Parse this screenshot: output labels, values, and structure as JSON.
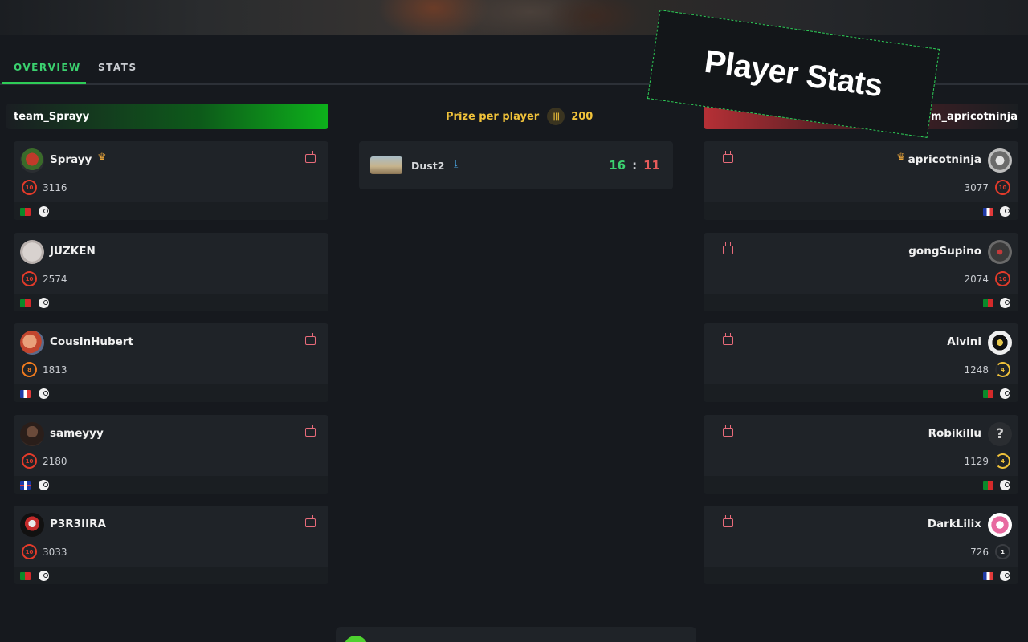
{
  "tabs": [
    {
      "label": "OVERVIEW",
      "active": true
    },
    {
      "label": "STATS",
      "active": false
    }
  ],
  "teams": {
    "left": {
      "name": "team_Sprayy",
      "color": "#0db21b"
    },
    "right": {
      "name": "team_apricotninja",
      "visible_name": "am_apricotninja",
      "color": "#b63036"
    }
  },
  "prize": {
    "label": "Prize per player",
    "amount": "200",
    "icon": "coin-icon"
  },
  "match": {
    "map": "Dust2",
    "score_left": "16",
    "score_sep": ":",
    "score_right": "11"
  },
  "players_left": [
    {
      "name": "Sprayy",
      "elo": "3116",
      "level": "10",
      "captain": true,
      "flag": "pt"
    },
    {
      "name": "JUZKEN",
      "elo": "2574",
      "level": "10",
      "captain": false,
      "flag": "pt"
    },
    {
      "name": "CousinHubert",
      "elo": "1813",
      "level": "8",
      "captain": false,
      "flag": "fr"
    },
    {
      "name": "sameyyy",
      "elo": "2180",
      "level": "10",
      "captain": false,
      "flag": "gb"
    },
    {
      "name": "P3R3IIRA",
      "elo": "3033",
      "level": "10",
      "captain": false,
      "flag": "pt"
    }
  ],
  "players_right": [
    {
      "name": "apricotninja",
      "elo": "3077",
      "level": "10",
      "captain": true,
      "flag": "fr"
    },
    {
      "name": "gongSupino",
      "elo": "2074",
      "level": "10",
      "captain": false,
      "flag": "pt"
    },
    {
      "name": "Alvini",
      "elo": "1248",
      "level": "4",
      "captain": false,
      "flag": "pt"
    },
    {
      "name": "Robikillu",
      "elo": "1129",
      "level": "4",
      "captain": false,
      "flag": "pt"
    },
    {
      "name": "DarkLilix",
      "elo": "726",
      "level": "1",
      "captain": false,
      "flag": "fr"
    }
  ],
  "overlay": {
    "title": "Player Stats"
  },
  "colors": {
    "accent": "#2ecc57",
    "win": "#3bd16f",
    "loss": "#e85a5a",
    "prize": "#f0c23a",
    "background": "#16191e"
  }
}
